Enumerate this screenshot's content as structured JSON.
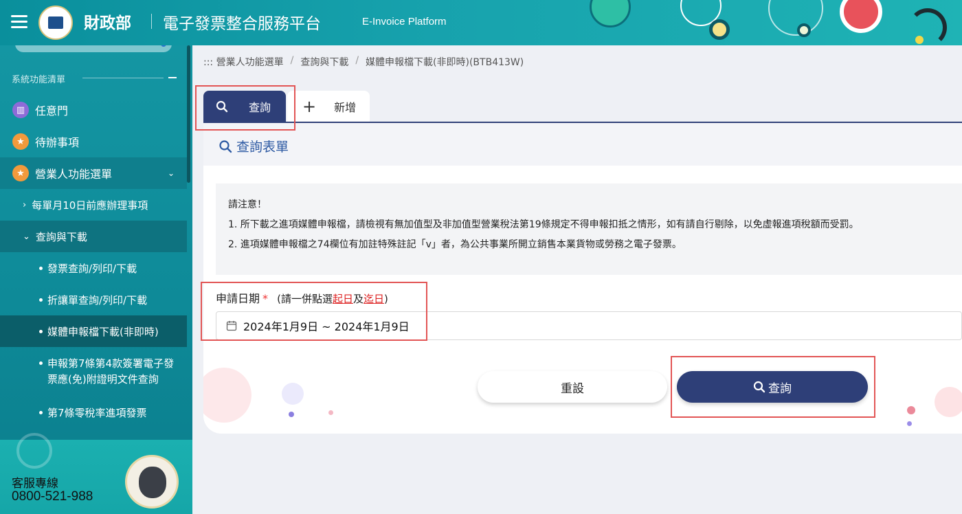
{
  "header": {
    "ministry": "財政部",
    "title": "電子發票整合服務平台",
    "subtitle_en": "E-Invoice Platform"
  },
  "sidebar": {
    "heading": "系統功能清單",
    "items": [
      {
        "label": "任意門",
        "icon": "map-icon",
        "color": "#8e6bd8"
      },
      {
        "label": "待辦事項",
        "icon": "star-icon",
        "color": "#f29a3c"
      },
      {
        "label": "營業人功能選單",
        "icon": "star-icon",
        "color": "#f29a3c"
      }
    ],
    "sub_items": [
      {
        "label": "每單月10日前應辦理事項"
      },
      {
        "label": "查詢與下載"
      }
    ],
    "leaf_items": [
      {
        "label": "發票查詢/列印/下載"
      },
      {
        "label": "折讓單查詢/列印/下載"
      },
      {
        "label": "媒體申報檔下載(非即時)"
      },
      {
        "label_line1": "申報第7條第4款簽署電子發",
        "label_line2": "票應(免)附證明文件查詢"
      },
      {
        "label": "第7條零稅率進項發票"
      }
    ],
    "hotline_label": "客服專線",
    "hotline_number": "0800-521-988"
  },
  "breadcrumb": {
    "items": [
      "::: 營業人功能選單",
      "查詢與下載",
      "媒體申報檔下載(非即時)(BTB413W)"
    ]
  },
  "tabs": [
    {
      "label": "查詢",
      "icon": "search-icon"
    },
    {
      "label": "新增",
      "icon": "plus-icon"
    }
  ],
  "form": {
    "title": "查詢表單",
    "notice_title": "請注意！",
    "notice_line1": "1. 所下載之進項媒體申報檔，請檢視有無加值型及非加值型營業稅法第19條規定不得申報扣抵之情形，如有請自行剔除，以免虛報進項稅額而受罰。",
    "notice_line2": "2. 進項媒體申報檔之74欄位有加註特殊註記「v」者，為公共事業所開立銷售本業貨物或勞務之電子發票。",
    "date_label": "申請日期",
    "required_mark": "*",
    "hint_prefix": "(請一併點選",
    "hint_start": "起日",
    "hint_mid": "及",
    "hint_end": "迄日",
    "hint_suffix": ")",
    "date_value": "2024年1月9日 ~ 2024年1月9日",
    "reset_label": "重設",
    "query_label": "查詢"
  },
  "colors": {
    "primary": "#2e3f78",
    "teal": "#0e8a98",
    "highlight": "#e25454"
  }
}
